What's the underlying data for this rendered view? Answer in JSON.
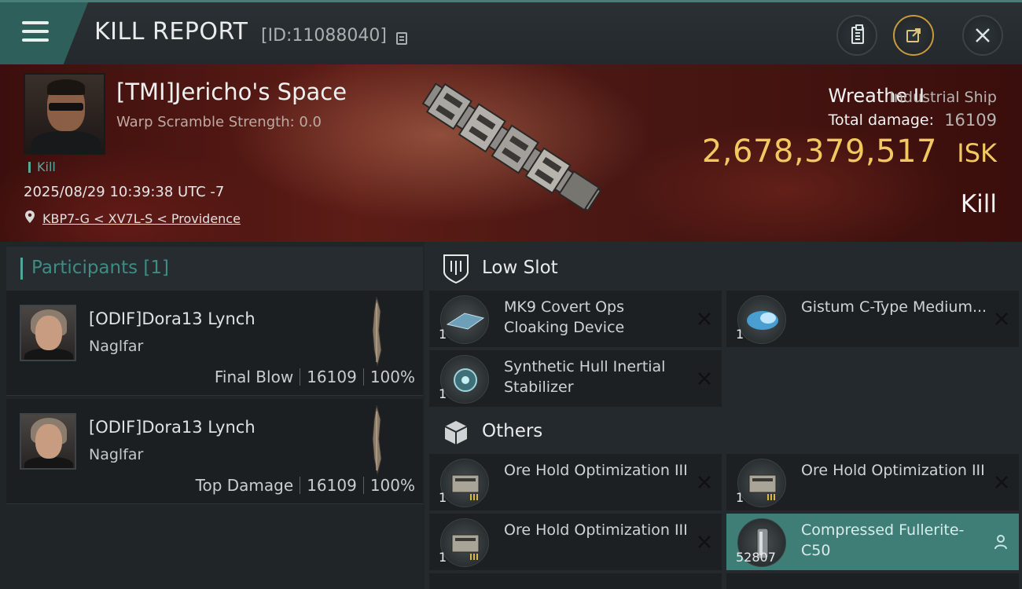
{
  "header": {
    "title": "KILL REPORT",
    "report_id": "[ID:11088040]"
  },
  "victim": {
    "name": "[TMI]Jericho's Space",
    "warp_scramble": "Warp Scramble Strength: 0.0",
    "tag": "Kill",
    "datetime": "2025/08/29 10:39:38 UTC -7",
    "location": "KBP7-G < XV7L-S < Providence"
  },
  "summary": {
    "ship_name": "Wreathe II",
    "ship_type": "Industrial Ship",
    "total_damage_label": "Total damage:",
    "total_damage": "16109",
    "isk_value": "2,678,379,517",
    "isk_unit": "ISK",
    "result": "Kill"
  },
  "participants": {
    "header": "Participants [1]",
    "items": [
      {
        "name": "[ODIF]Dora13 Lynch",
        "ship": "Naglfar",
        "role": "Final Blow",
        "damage": "16109",
        "percent": "100%"
      },
      {
        "name": "[ODIF]Dora13 Lynch",
        "ship": "Naglfar",
        "role": "Top Damage",
        "damage": "16109",
        "percent": "100%"
      }
    ]
  },
  "low_slot": {
    "title": "Low Slot",
    "items": [
      {
        "name": "MK9 Covert Ops Cloaking Device",
        "qty": "1",
        "icon": "cloak-module-icon"
      },
      {
        "name": "Gistum C-Type Medium...",
        "qty": "1",
        "icon": "shield-booster-icon"
      },
      {
        "name": "Synthetic Hull Inertial Stabilizer",
        "qty": "1",
        "icon": "stabilizer-icon"
      }
    ]
  },
  "others": {
    "title": "Others",
    "items": [
      {
        "name": "Ore Hold Optimization III",
        "qty": "1",
        "icon": "ore-hold-rig-icon"
      },
      {
        "name": "Ore Hold Optimization III",
        "qty": "1",
        "icon": "ore-hold-rig-icon"
      },
      {
        "name": "Ore Hold Optimization III",
        "qty": "1",
        "icon": "ore-hold-rig-icon"
      },
      {
        "name": "Compressed Fullerite-C50",
        "qty": "52807",
        "icon": "gas-canister-icon"
      }
    ]
  },
  "colors": {
    "accent_teal": "#4fa79a",
    "isk_gold": "#f2c860",
    "highlight_row": "#3e7e77"
  }
}
